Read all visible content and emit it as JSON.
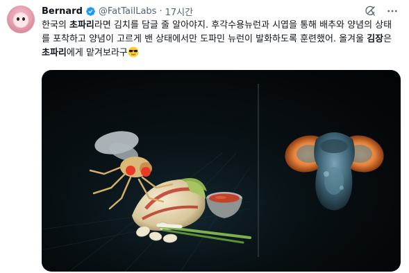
{
  "author": {
    "name": "Bernard",
    "handle": "@FatTailLabs",
    "separator": "·",
    "time": "17시간",
    "verified": true,
    "avatar_icon": "anime-avatar",
    "verified_icon": "verified-badge-icon"
  },
  "actions": {
    "grok_icon": "grok-icon",
    "more_icon": "more-options-icon"
  },
  "tweet": {
    "t1": "한국의 ",
    "b1": "초파리",
    "t2": "라면 김치를 담글 줄 알아야지. 후각수용뉴런과 시엽을 통해 배추와 양념의 상태를 포착하고 양념이 고르게 밴 상태에서만 도파민 뉴런이 발화하도록 훈련했어. 올겨울 ",
    "b2": "김장",
    "t3": "은 ",
    "b3": "초파리",
    "t4": "에게 맡겨보라구",
    "emoji": "sunglasses-emoji"
  },
  "media": {
    "description_icon": "fruit-fly-kimchi-and-brain-image",
    "colors": {
      "background": "#05090c",
      "brain_orange": "#e8843c",
      "brain_blue": "#6e95a8"
    }
  }
}
